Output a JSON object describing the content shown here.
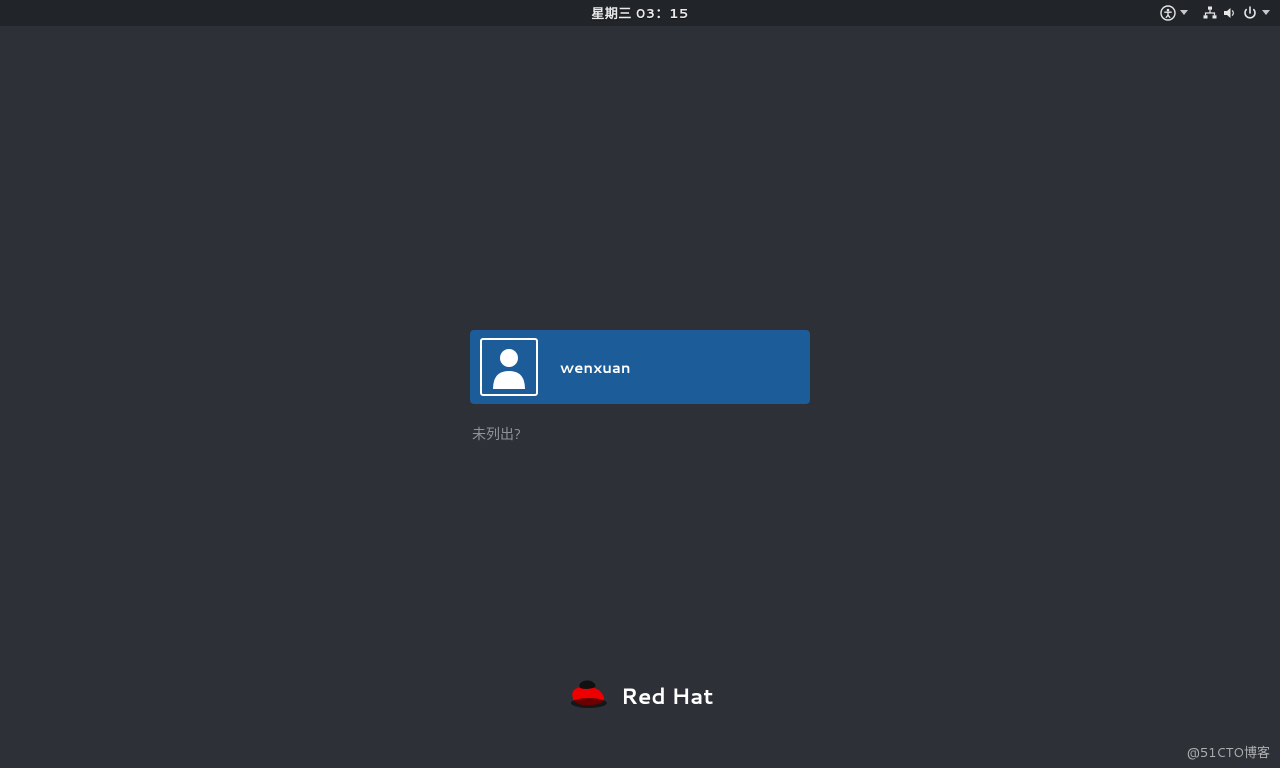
{
  "topbar": {
    "clock": "星期三 03：15"
  },
  "login": {
    "users": [
      {
        "name": "wenxuan"
      }
    ],
    "not_listed_label": "未列出?"
  },
  "branding": {
    "name": "Red Hat"
  },
  "watermark": "@51CTO博客",
  "icons": {
    "accessibility": "accessibility-icon",
    "network": "network-icon",
    "volume": "volume-icon",
    "power": "power-icon"
  },
  "colors": {
    "background": "#2d3137",
    "user_bg": "#1c5d99",
    "brand_accent": "#ee0000"
  }
}
